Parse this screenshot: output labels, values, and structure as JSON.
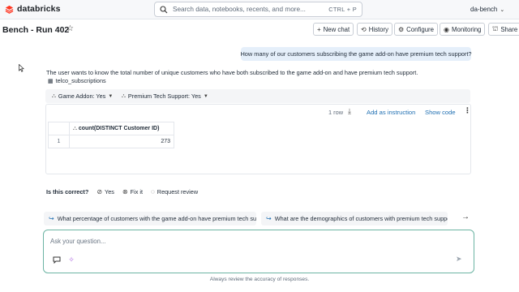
{
  "brand": {
    "name": "databricks",
    "color": "#ff3621"
  },
  "search": {
    "placeholder": "Search data, notebooks, recents, and more...",
    "shortcut": "CTRL + P"
  },
  "workspace": {
    "label": "da-bench"
  },
  "page": {
    "title": "Bench - Run 402"
  },
  "toolbar": {
    "new_chat": "New chat",
    "history": "History",
    "configure": "Configure",
    "monitoring": "Monitoring",
    "share": "Share"
  },
  "chat": {
    "user_message": "How many of our customers subscribing the game add-on have premium tech support?",
    "answer": "The user wants to know the total number of unique customers who have both subscribed to the game add-on and have premium tech support.",
    "table_ref": "telco_subscriptions",
    "filters": [
      {
        "label": "Game Addon: Yes",
        "icon": "filter-icon"
      },
      {
        "label": "Premium Tech Support: Yes",
        "icon": "filter-icon"
      }
    ],
    "result": {
      "row_count": "1 row",
      "add_instruction": "Add as instruction",
      "show_code": "Show code",
      "columns": [
        "count(DISTINCT Customer ID)"
      ],
      "rows": [
        {
          "index": "1",
          "values": [
            "273"
          ]
        }
      ]
    },
    "feedback": {
      "question": "Is this correct?",
      "yes": "Yes",
      "fix": "Fix it",
      "review": "Request review"
    },
    "suggestions": [
      "What percentage of customers with the game add-on have premium tech support?",
      "What are the demographics of customers with premium tech support?"
    ]
  },
  "composer": {
    "placeholder": "Ask your question..."
  },
  "footer": {
    "disclaimer": "Always review the accuracy of responses."
  },
  "colors": {
    "accent_link": "#1f6fb2",
    "user_bubble": "#e5effa",
    "composer_border": "#6cb4a3"
  }
}
